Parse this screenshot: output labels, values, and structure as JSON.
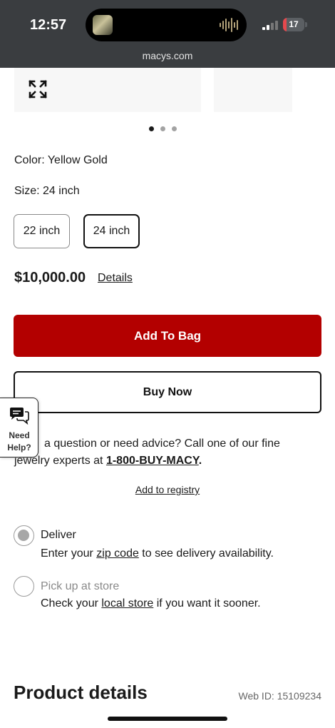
{
  "status_bar": {
    "time": "12:57",
    "battery": "17",
    "battery_level": 0.17,
    "signal_bars_active": 2,
    "url": "macys.com"
  },
  "gallery": {
    "expand_icon": "expand-arrows-icon",
    "page_count": 3,
    "active_page": 1
  },
  "product": {
    "color_label": "Color: Yellow Gold",
    "size_label": "Size: 24 inch",
    "sizes": [
      "22 inch",
      "24 inch"
    ],
    "selected_size": "24 inch",
    "price": "$10,000.00",
    "details_link": "Details"
  },
  "actions": {
    "add_to_bag": "Add To Bag",
    "buy_now": "Buy Now"
  },
  "advice": {
    "text": "a question or need advice? Call one of our fine jewelry experts at ",
    "phone": "1-800-BUY-MACY",
    "period": "."
  },
  "registry": {
    "label": "Add to registry"
  },
  "fulfillment": {
    "deliver_title": "Deliver",
    "deliver_pre": "Enter your ",
    "deliver_link": "zip code",
    "deliver_post": " to see delivery availability.",
    "pickup_title": "Pick up at store",
    "pickup_pre": "Check your ",
    "pickup_link": "local store",
    "pickup_post": " if you want it sooner."
  },
  "need_help": {
    "line1": "Need",
    "line2": "Help?",
    "icon": "chat-bubbles-icon"
  },
  "product_details": {
    "title": "Product details",
    "web_id": "Web ID: 15109234"
  },
  "colors": {
    "brand_red": "#b30000",
    "status_bar_bg": "#3a3d40",
    "battery_low": "#e5484d"
  }
}
